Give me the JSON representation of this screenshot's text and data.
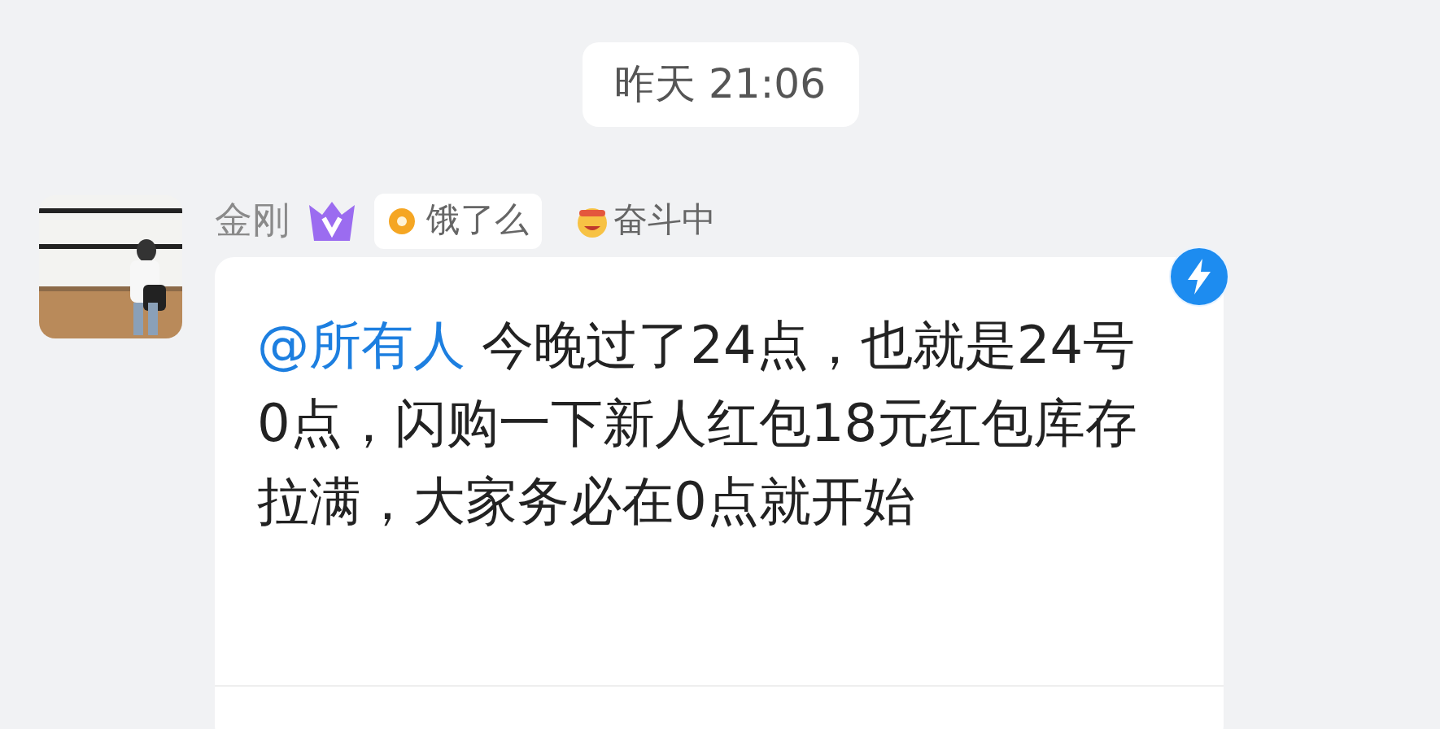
{
  "timestamp": "昨天 21:06",
  "message": {
    "sender": "金刚",
    "org_badge": "饿了么",
    "status": "奋斗中",
    "mention": "@所有人",
    "text": " 今晚过了24点，也就是24号0点，闪购一下新人红包18元红包库存拉满，大家务必在0点就开始",
    "flash": true
  }
}
